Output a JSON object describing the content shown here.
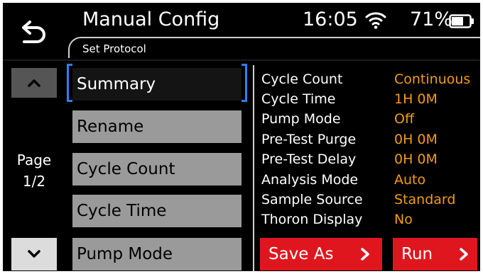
{
  "header": {
    "title": "Manual Config",
    "subtitle": "Set Protocol",
    "time": "16:05",
    "battery_percent": "71%",
    "icons": [
      "back-arrow-icon",
      "wifi-icon",
      "battery-icon"
    ]
  },
  "pager": {
    "page_word": "Page",
    "page_value": "1/2",
    "icons": [
      "chevron-up-icon",
      "chevron-down-icon"
    ]
  },
  "menu": {
    "items": [
      "Summary",
      "Rename",
      "Cycle Count",
      "Cycle Time",
      "Pump Mode"
    ],
    "selected_index": 0
  },
  "details": [
    {
      "label": "Cycle Count",
      "value": "Continuous"
    },
    {
      "label": "Cycle Time",
      "value": "1H 0M"
    },
    {
      "label": "Pump Mode",
      "value": "Off"
    },
    {
      "label": "Pre-Test Purge",
      "value": "0H 0M"
    },
    {
      "label": "Pre-Test Delay",
      "value": "0H 0M"
    },
    {
      "label": "Analysis Mode",
      "value": "Auto"
    },
    {
      "label": "Sample Source",
      "value": "Standard"
    },
    {
      "label": "Thoron Display",
      "value": "No"
    }
  ],
  "actions": {
    "save_as": "Save As",
    "run": "Run",
    "icons": [
      "chevron-right-icon"
    ]
  },
  "colors": {
    "background": "#000000",
    "accent_value": "#f39c12",
    "action_button": "#e0161f",
    "selection_bracket": "#2f7fff",
    "menu_button": "#9a9a9a"
  }
}
